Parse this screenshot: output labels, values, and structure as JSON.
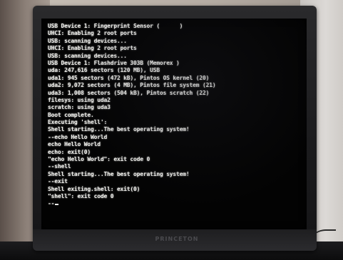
{
  "monitor": {
    "brand": "PRINCETON"
  },
  "console": {
    "lines": [
      "USB Device 1: Fingerprint Sensor (      )",
      "UHCI: Enabling 2 root ports",
      "USB: scanning devices...",
      "UHCI: Enabling 2 root ports",
      "USB: scanning devices...",
      "USB Device 1: Flashdrive 303B (Memorex )",
      "uda: 247,616 sectors (120 MB), USB",
      "uda1: 945 sectors (472 kB), Pintos OS kernel (20)",
      "uda2: 9,072 sectors (4 MB), Pintos file system (21)",
      "uda3: 1,008 sectors (504 kB), Pintos scratch (22)",
      "filesys: using uda2",
      "scratch: using uda3",
      "Boot complete.",
      "Executing 'shell':",
      "Shell starting...The best operating system!",
      "--echo Hello World",
      "echo Hello World",
      "echo: exit(0)",
      "\"echo Hello World\": exit code 0",
      "--shell",
      "Shell starting...The best operating system!",
      "--exit",
      "Shell exiting.shell: exit(0)",
      "\"shell\": exit code 0",
      "--"
    ]
  }
}
